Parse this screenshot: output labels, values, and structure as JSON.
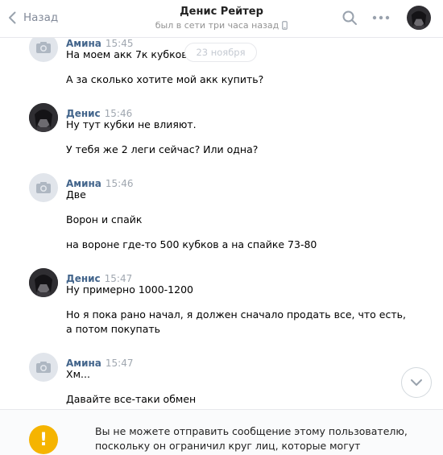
{
  "header": {
    "back_label": "Назад",
    "peer_name": "Денис Рейтер",
    "peer_status": "был в сети три часа назад",
    "icons": {
      "back": "chevron-left-icon",
      "search": "search-icon",
      "more": "more-icon",
      "device": "phone-icon"
    }
  },
  "date_divider": "23 ноября",
  "messages": [
    {
      "author": "Амина",
      "time": "15:45",
      "lines": [
        "На моем акк 7к кубков",
        "А за сколько хотите мой акк купить?"
      ]
    },
    {
      "author": "Денис",
      "time": "15:46",
      "lines": [
        "Ну тут кубки не влияют.",
        "У тебя же 2 леги сейчас? Или одна?"
      ]
    },
    {
      "author": "Амина",
      "time": "15:46",
      "lines": [
        "Две",
        "Ворон и спайк",
        "на вороне где-то 500 кубков а на спайке 73-80"
      ]
    },
    {
      "author": "Денис",
      "time": "15:47",
      "lines": [
        "Ну примерно 1000-1200",
        "Но я пока рано начал, я должен сначало продать все, что есть,",
        "а потом покупать"
      ]
    },
    {
      "author": "Амина",
      "time": "15:47",
      "lines": [
        "Хм...",
        "Давайте все-таки обмен"
      ]
    }
  ],
  "notice": {
    "icon": "!",
    "text": "Вы не можете отправить сообщение этому пользователю, поскольку он ограничил круг лиц, которые могут присылать ему сообщения."
  },
  "colors": {
    "author": "#42648b",
    "warning": "#f5b400"
  }
}
